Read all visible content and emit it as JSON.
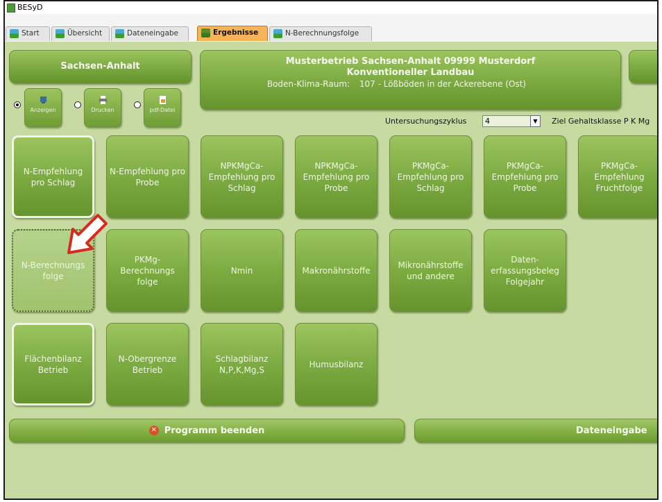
{
  "app": {
    "title": "BESyD"
  },
  "tabs": [
    {
      "label": "Start"
    },
    {
      "label": "Übersicht"
    },
    {
      "label": "Dateneingabe"
    },
    {
      "label": "Ergebnisse"
    },
    {
      "label": "N-Berechnungsfolge"
    }
  ],
  "header": {
    "state_button": "Sachsen-Anhalt",
    "farm_line1": "Musterbetrieb Sachsen-Anhalt  09999  Musterdorf",
    "farm_line2": "Konventioneller Landbau",
    "region_label": "Boden-Klima-Raum:",
    "region_value": "107 - Lößböden in der Ackerebene (Ost)"
  },
  "output_options": [
    {
      "label": "Anzeigen",
      "icon": "screen-icon"
    },
    {
      "label": "Drucken",
      "icon": "printer-icon"
    },
    {
      "label": "pdf-Datei",
      "icon": "pdf-icon"
    }
  ],
  "filters": {
    "cycle_label": "Untersuchungszyklus",
    "cycle_value": "4",
    "target_label": "Ziel Gehaltsklasse P K Mg"
  },
  "tiles_row1": [
    {
      "label": "N-Empfehlung pro Schlag"
    },
    {
      "label": "N-Empfehlung pro Probe"
    },
    {
      "label": "NPKMgCa-Empfehlung pro Schlag"
    },
    {
      "label": "NPKMgCa-Empfehlung pro Probe"
    },
    {
      "label": "PKMgCa-Empfehlung pro Schlag"
    },
    {
      "label": "PKMgCa-Empfehlung pro Probe"
    },
    {
      "label": "PKMgCa-Empfehlung Fruchtfolge"
    }
  ],
  "tiles_row2": [
    {
      "label": "N-Berechnungs folge"
    },
    {
      "label": "PKMg-Berechnungs folge"
    },
    {
      "label": "Nmin"
    },
    {
      "label": "Makronährstoffe"
    },
    {
      "label": "Mikronährstoffe und andere"
    },
    {
      "label": "Daten-erfassungsbeleg Folgejahr"
    }
  ],
  "tiles_row3": [
    {
      "label": "Flächenbilanz Betrieb"
    },
    {
      "label": "N-Obergrenze Betrieb"
    },
    {
      "label": "Schlagbilanz N,P,K,Mg,S"
    },
    {
      "label": "Humusbilanz"
    }
  ],
  "footer": {
    "exit_label": "Programm beenden",
    "data_entry_label": "Dateneingabe"
  },
  "colors": {
    "background": "#c7daa1",
    "button": "#7aa940",
    "active_tab": "#f6b357",
    "arrow": "#d62b1f"
  }
}
